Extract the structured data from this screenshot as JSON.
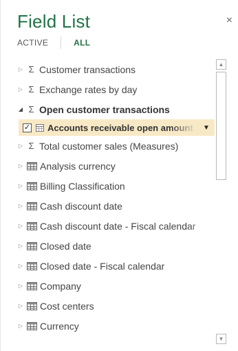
{
  "pane": {
    "title": "Field List",
    "close_glyph": "×",
    "tabs": {
      "active_label": "ACTIVE",
      "all_label": "ALL",
      "selected": "ALL"
    },
    "accent_color": "#217346",
    "highlight_color": "#f8e9c6"
  },
  "fields": {
    "customer_transactions": {
      "label": "Customer transactions",
      "icon": "sigma-icon",
      "expanded": false
    },
    "exchange_rates": {
      "label": "Exchange rates by day",
      "icon": "sigma-icon",
      "expanded": false
    },
    "open_customer_transactions": {
      "label": "Open customer transactions",
      "icon": "sigma-icon",
      "expanded": true,
      "children": [
        {
          "label": "Accounts receivable open amount",
          "checked": true,
          "icon": "field-icon"
        }
      ]
    },
    "total_customer_sales": {
      "label": "Total customer sales (Measures)",
      "icon": "sigma-icon",
      "expanded": false
    },
    "tables": [
      {
        "label": "Analysis currency",
        "icon": "table-icon"
      },
      {
        "label": "Billing Classification",
        "icon": "table-icon"
      },
      {
        "label": "Cash discount date",
        "icon": "table-icon"
      },
      {
        "label": "Cash discount date - Fiscal calendar",
        "icon": "table-icon"
      },
      {
        "label": "Closed date",
        "icon": "table-icon"
      },
      {
        "label": "Closed date - Fiscal calendar",
        "icon": "table-icon"
      },
      {
        "label": "Company",
        "icon": "table-icon"
      },
      {
        "label": "Cost centers",
        "icon": "table-icon"
      },
      {
        "label": "Currency",
        "icon": "table-icon"
      }
    ]
  },
  "glyphs": {
    "collapsed": "▷",
    "expanded": "◢",
    "sigma": "Σ",
    "check": "✓",
    "dropdown": "▼",
    "scroll_up": "▲",
    "scroll_down": "▼"
  }
}
